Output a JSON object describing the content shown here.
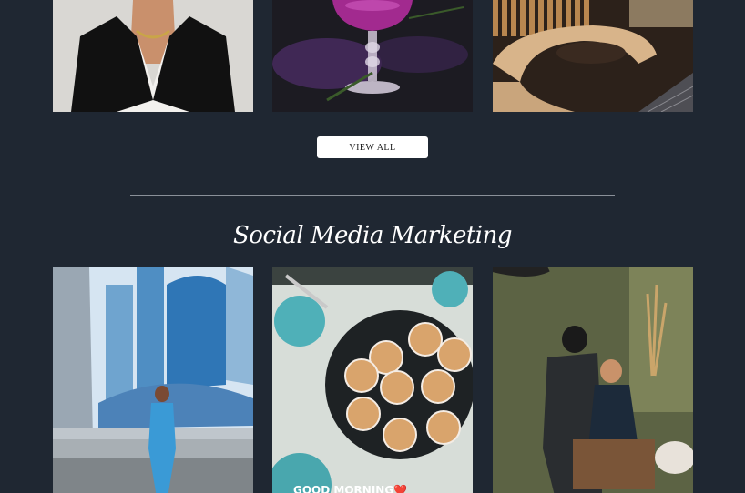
{
  "gallery_top": {
    "images": [
      {
        "alt": "Portrait of woman in black blazer"
      },
      {
        "alt": "Purple cocktail with flowers"
      },
      {
        "alt": "Restaurant interior with wooden booth"
      }
    ]
  },
  "view_all_button": {
    "label": "VIEW ALL"
  },
  "social_section": {
    "title": "Social Media Marketing",
    "images": [
      {
        "alt": "Woman in blue outfit near city skyscrapers"
      },
      {
        "alt": "Plate of pastries with powdered sugar",
        "caption": "GOOD MORNING❤️"
      },
      {
        "alt": "Makeup artist working on client"
      }
    ]
  },
  "colors": {
    "background": "#1f2732",
    "button_bg": "#ffffff",
    "divider": "#8a9099"
  }
}
